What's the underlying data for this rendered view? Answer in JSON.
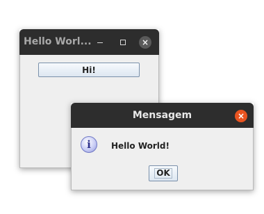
{
  "main_window": {
    "title": "Hello Worl...",
    "hi_button_label": "Hi!",
    "close_glyph": "×"
  },
  "dialog": {
    "title": "Mensagem",
    "info_glyph": "i",
    "message": "Hello World!",
    "ok_label": "OK",
    "close_glyph": "×"
  },
  "colors": {
    "titlebar": "#2d2d2d",
    "window_body": "#efefef",
    "dialog_close_accent": "#e95420",
    "button_border": "#7a90aa"
  },
  "icons": [
    "minimize-icon",
    "maximize-icon",
    "close-icon",
    "info-icon"
  ]
}
